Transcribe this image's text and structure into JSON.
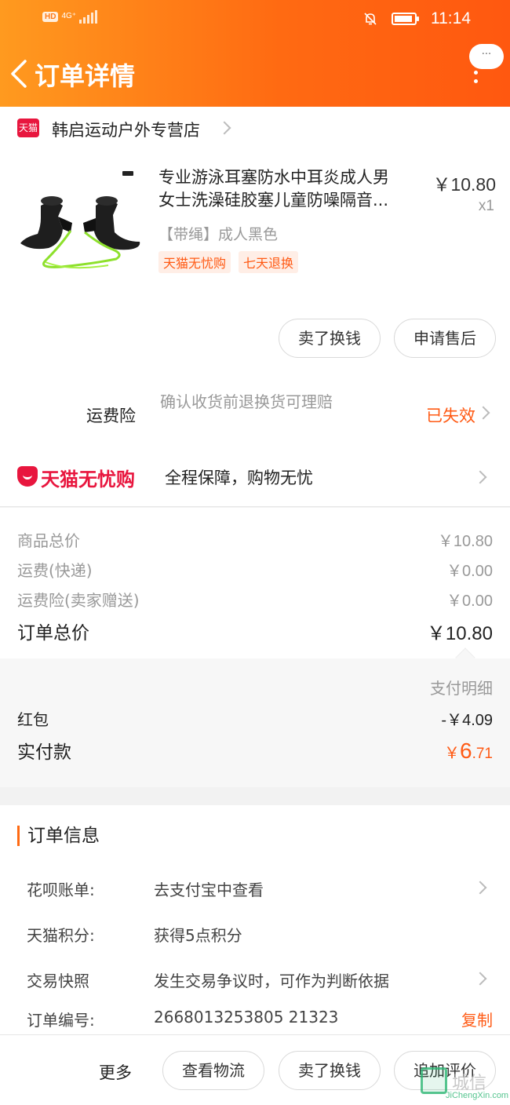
{
  "status_bar": {
    "hd": "HD",
    "network": "4G⁺",
    "time": "11:14"
  },
  "nav": {
    "title": "订单详情",
    "more_bubble": "···"
  },
  "store": {
    "badge": "天猫",
    "name": "韩启运动户外专营店"
  },
  "product": {
    "title_line1": "专业游泳耳塞防水中耳炎成人男",
    "title_line2": "女士洗澡硅胶塞儿童防噪隔音...",
    "price": "￥10.80",
    "qty": "x1",
    "sku": "【带绳】成人黑色",
    "tags": [
      "天猫无忧购",
      "七天退换"
    ],
    "image_badge": "▪▪"
  },
  "product_actions": {
    "sell": "卖了换钱",
    "after_sale": "申请售后"
  },
  "insurance": {
    "label": "运费险",
    "desc": "确认收货前退换货可理赔",
    "status": "已失效"
  },
  "guarantee": {
    "brand": "天猫无忧购",
    "desc": "全程保障，购物无忧"
  },
  "summary": {
    "rows": [
      {
        "label": "商品总价",
        "value": "￥10.80"
      },
      {
        "label": "运费(快递)",
        "value": "￥0.00"
      },
      {
        "label": "运费险(卖家赠送)",
        "value": "￥0.00"
      }
    ],
    "total_label": "订单总价",
    "total_value": "￥10.80"
  },
  "payment": {
    "detail_label": "支付明细",
    "redpacket_label": "红包",
    "redpacket_value": "-￥4.09",
    "paid_label": "实付款",
    "paid_currency": "￥",
    "paid_int": "6",
    "paid_dec": ".71"
  },
  "order_info": {
    "title": "订单信息",
    "rows": [
      {
        "label": "花呗账单:",
        "value": "去支付宝中查看"
      },
      {
        "label": "天猫积分:",
        "value": "获得5点积分"
      },
      {
        "label": "交易快照",
        "value": "发生交易争议时，可作为判断依据"
      },
      {
        "label": "订单编号:",
        "value": "2668013253805 21323"
      }
    ],
    "copy": "复制"
  },
  "bottom_bar": {
    "more": "更多",
    "logistics": "查看物流",
    "sell": "卖了换钱",
    "review": "追加评价"
  },
  "watermark": {
    "text": "城信",
    "sub": "JiChengXin.com"
  },
  "colors": {
    "accent": "#ff6a12",
    "tmall_red": "#e8163e",
    "price_orange": "#ff5a14"
  }
}
